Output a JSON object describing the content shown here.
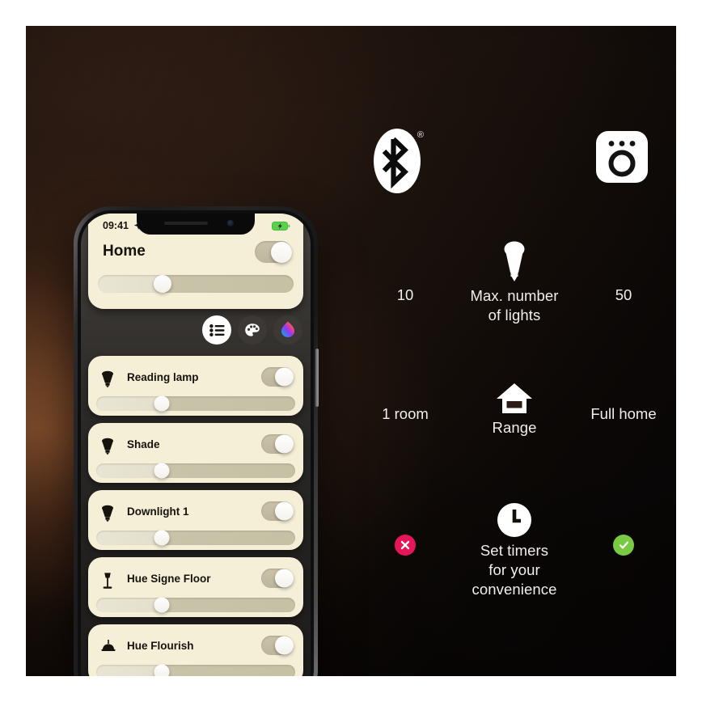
{
  "canvas": {
    "background_top": "#3a251a",
    "background_glow": "#c47642",
    "background_dark": "#070505"
  },
  "top_icons": {
    "bluetooth": {
      "name": "bluetooth-logo",
      "registered_mark": "®"
    },
    "bridge": {
      "name": "hue-bridge-icon"
    }
  },
  "comparison": {
    "rows": [
      {
        "icon": "light-bulb-icon",
        "label": "Max. number\nof lights",
        "label_line1": "Max. number",
        "label_line2": "of lights",
        "left_value": "10",
        "right_value": "50",
        "left_type": "text",
        "right_type": "text"
      },
      {
        "icon": "house-range-icon",
        "label": "Range",
        "label_line1": "Range",
        "label_line2": "",
        "left_value": "1 room",
        "right_value": "Full home",
        "left_type": "text",
        "right_type": "text"
      },
      {
        "icon": "clock-timer-icon",
        "label": "Set timers for your convenience",
        "label_line1": "Set timers",
        "label_line2": "for your",
        "label_line3": "convenience",
        "left_value": "",
        "right_value": "",
        "left_type": "badge-x",
        "right_type": "badge-check"
      }
    ],
    "badge_colors": {
      "negative": "#e6155a",
      "positive": "#7ac943"
    }
  },
  "phone": {
    "status_bar": {
      "time": "09:41",
      "location_icon": "location-arrow-icon",
      "battery_icon": "battery-charging-icon",
      "battery_color": "#5bd14e"
    },
    "header": {
      "title": "Home",
      "toggle_on": true,
      "brightness_percent": 33
    },
    "mode_buttons": [
      {
        "name": "list-view-icon",
        "label": "List view",
        "active": true
      },
      {
        "name": "palette-icon",
        "label": "Scenes",
        "active": false
      },
      {
        "name": "color-picker-icon",
        "label": "Color picker",
        "active": false
      }
    ],
    "lights": [
      {
        "name": "Reading lamp",
        "icon": "spot-bulb-icon",
        "toggle_on": true,
        "brightness_percent": 33
      },
      {
        "name": "Shade",
        "icon": "spot-bulb-icon",
        "toggle_on": true,
        "brightness_percent": 33
      },
      {
        "name": "Downlight 1",
        "icon": "spot-bulb-icon",
        "toggle_on": true,
        "brightness_percent": 33
      },
      {
        "name": "Hue Signe Floor",
        "icon": "floor-lamp-icon",
        "toggle_on": true,
        "brightness_percent": 33
      },
      {
        "name": "Hue Flourish",
        "icon": "ceiling-lamp-icon",
        "toggle_on": true,
        "brightness_percent": 33
      }
    ]
  }
}
